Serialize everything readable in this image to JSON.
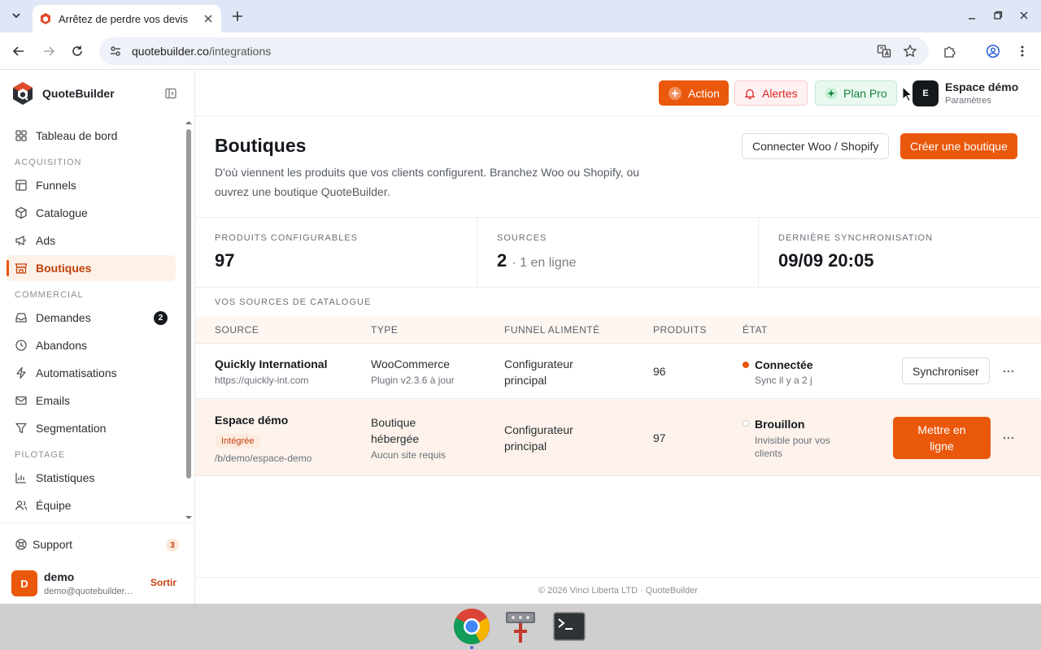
{
  "browser": {
    "tab_title": "Arrêtez de perdre vos devis",
    "url_host": "quotebuilder.co",
    "url_path": "/integrations"
  },
  "sidebar": {
    "brand": "QuoteBuilder",
    "items": [
      {
        "label": "Tableau de bord",
        "icon": "grid-icon"
      },
      {
        "section": "ACQUISITION"
      },
      {
        "label": "Funnels",
        "icon": "layout-icon"
      },
      {
        "label": "Catalogue",
        "icon": "box-icon"
      },
      {
        "label": "Ads",
        "icon": "megaphone-icon"
      },
      {
        "label": "Boutiques",
        "icon": "store-icon",
        "active": true
      },
      {
        "section": "COMMERCIAL"
      },
      {
        "label": "Demandes",
        "icon": "inbox-icon",
        "badge": "2"
      },
      {
        "label": "Abandons",
        "icon": "clock-icon"
      },
      {
        "label": "Automatisations",
        "icon": "bolt-icon"
      },
      {
        "label": "Emails",
        "icon": "mail-icon"
      },
      {
        "label": "Segmentation",
        "icon": "filter-icon"
      },
      {
        "section": "PILOTAGE"
      },
      {
        "label": "Statistiques",
        "icon": "chart-icon"
      },
      {
        "label": "Équipe",
        "icon": "users-icon"
      }
    ],
    "support": {
      "label": "Support",
      "badge": "3"
    },
    "user": {
      "initial": "D",
      "name": "demo",
      "email": "demo@quotebuilder.co",
      "logout": "Sortir"
    }
  },
  "topbar": {
    "action": "Action",
    "alerts": "Alertes",
    "plan": "Plan Pro",
    "workspace": {
      "initial": "E",
      "name": "Espace démo",
      "sub": "Paramètres"
    }
  },
  "page": {
    "title": "Boutiques",
    "description": "D'où viennent les produits que vos clients configurent. Branchez Woo ou Shopify, ou ouvrez une boutique QuoteBuilder.",
    "connect_btn": "Connecter Woo / Shopify",
    "create_btn": "Créer une boutique"
  },
  "stats": [
    {
      "label": "PRODUITS CONFIGURABLES",
      "value": "97",
      "sub": ""
    },
    {
      "label": "SOURCES",
      "value": "2",
      "sub": "· 1 en ligne"
    },
    {
      "label": "DERNIÈRE SYNCHRONISATION",
      "value": "09/09 20:05",
      "sub": ""
    }
  ],
  "table": {
    "section": "VOS SOURCES DE CATALOGUE",
    "headers": [
      "SOURCE",
      "TYPE",
      "FUNNEL ALIMENTÉ",
      "PRODUITS",
      "ÉTAT"
    ],
    "rows": [
      {
        "name": "Quickly International",
        "url": "https://quickly-int.com",
        "type": "WooCommerce",
        "type_sub": "Plugin v2.3.6 à jour",
        "funnel_1": "Configurateur",
        "funnel_2": "principal",
        "products": "96",
        "state": "Connectée",
        "state_sub": "Sync il y a 2 j",
        "state_color": "#ea580c",
        "action": "Synchroniser"
      },
      {
        "name": "Espace démo",
        "badge": "Intégrée",
        "url": "/b/demo/espace-demo",
        "type_1": "Boutique",
        "type_2": "hébergée",
        "type_sub": "Aucun site requis",
        "funnel_1": "Configurateur",
        "funnel_2": "principal",
        "products": "97",
        "state": "Brouillon",
        "state_sub_1": "Invisible pour vos",
        "state_sub_2": "clients",
        "action_1": "Mettre en",
        "action_2": "ligne"
      }
    ]
  },
  "footer": "© 2026 Vinci Liberta LTD · QuoteBuilder",
  "colors": {
    "accent": "#ea580c",
    "danger": "#dc2626",
    "success": "#15803d"
  }
}
